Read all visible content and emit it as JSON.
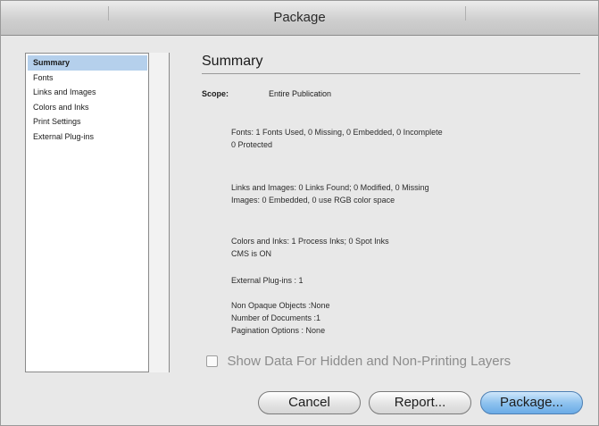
{
  "window": {
    "title": "Package"
  },
  "sidebar": {
    "items": [
      {
        "label": "Summary",
        "selected": true
      },
      {
        "label": "Fonts",
        "selected": false
      },
      {
        "label": "Links and Images",
        "selected": false
      },
      {
        "label": "Colors and Inks",
        "selected": false
      },
      {
        "label": "Print Settings",
        "selected": false
      },
      {
        "label": "External Plug-ins",
        "selected": false
      }
    ]
  },
  "main": {
    "title": "Summary",
    "scope_label": "Scope:",
    "scope_value": "Entire Publication",
    "fonts_line1": "Fonts: 1 Fonts Used, 0 Missing, 0 Embedded, 0 Incomplete",
    "fonts_line2": "0 Protected",
    "links_line1": "Links and Images: 0 Links Found; 0 Modified, 0 Missing",
    "links_line2": "Images: 0 Embedded, 0 use RGB color space",
    "colors_line1": "Colors and Inks: 1 Process Inks; 0 Spot Inks",
    "colors_line2": "CMS is ON",
    "plugins_line": "External Plug-ins : 1",
    "nonopaque_line": "Non Opaque Objects :None",
    "docs_line": "Number of Documents :1",
    "pagination_line": "Pagination Options : None",
    "checkbox_label": "Show Data For Hidden and Non-Printing Layers",
    "checkbox_checked": false
  },
  "buttons": {
    "cancel": "Cancel",
    "report": "Report...",
    "package": "Package..."
  }
}
